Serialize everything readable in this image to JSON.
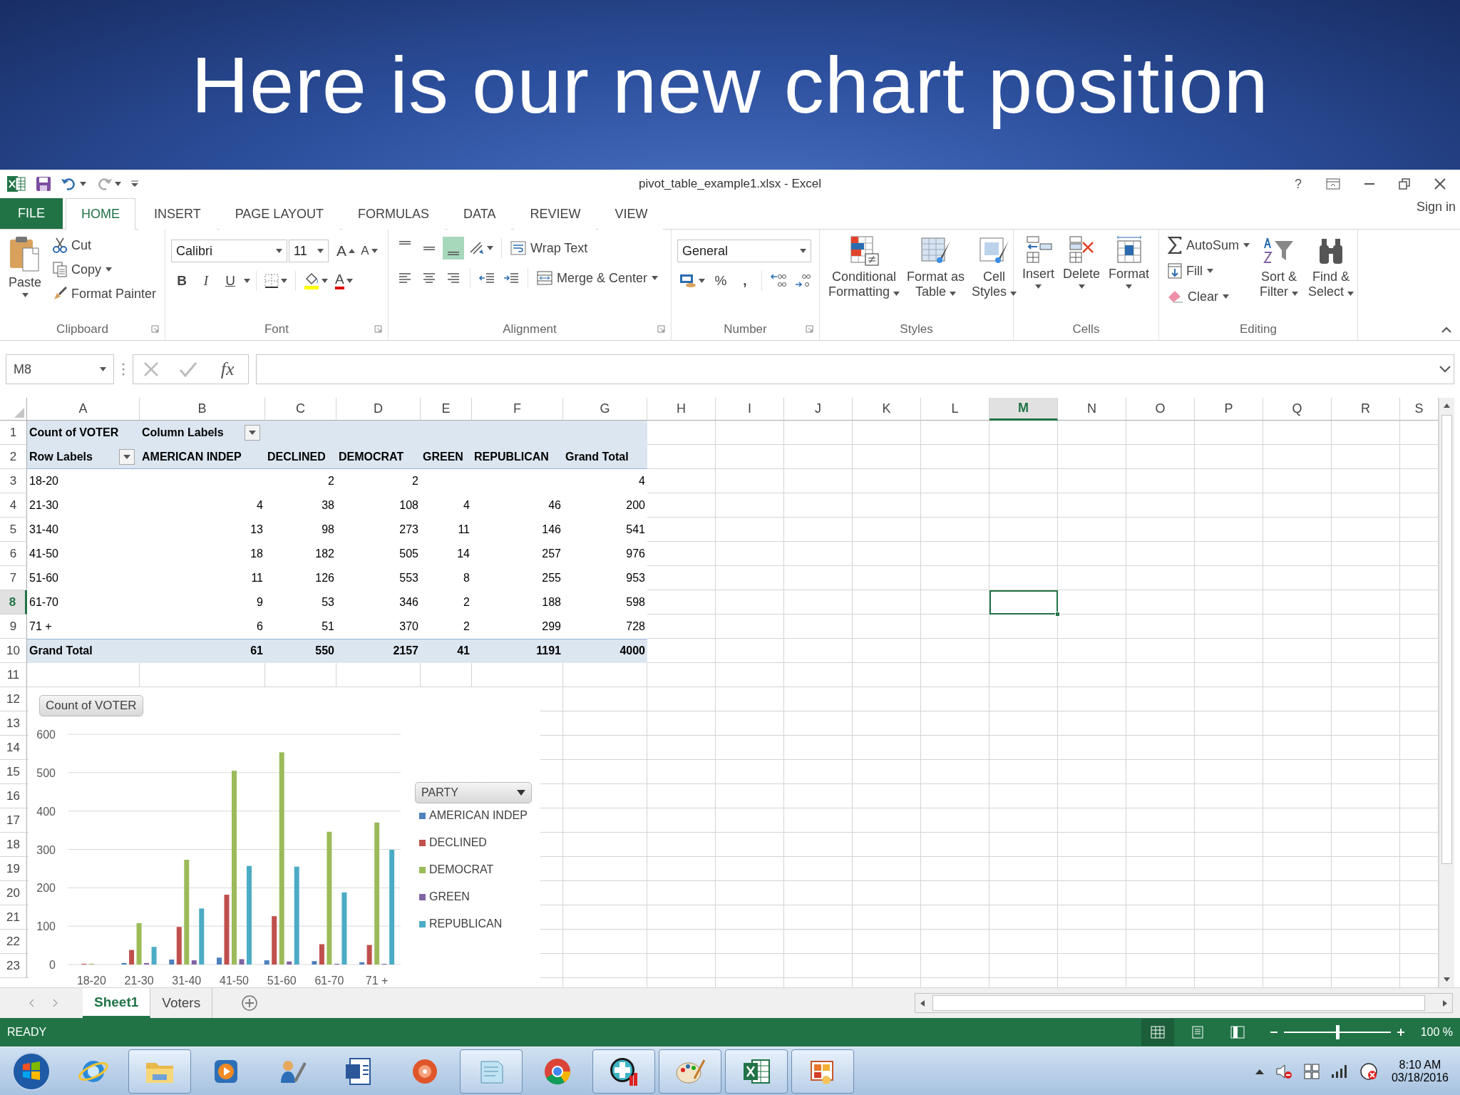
{
  "slide_title": "Here is our new chart position",
  "window": {
    "title": "pivot_table_example1.xlsx - Excel",
    "help": "?",
    "sign_in": "Sign in"
  },
  "ribbon_tabs": [
    {
      "label": "FILE",
      "kind": "file",
      "selected": false
    },
    {
      "label": "HOME",
      "kind": "tab",
      "selected": true
    },
    {
      "label": "INSERT",
      "kind": "tab",
      "selected": false
    },
    {
      "label": "PAGE LAYOUT",
      "kind": "tab",
      "selected": false
    },
    {
      "label": "FORMULAS",
      "kind": "tab",
      "selected": false
    },
    {
      "label": "DATA",
      "kind": "tab",
      "selected": false
    },
    {
      "label": "REVIEW",
      "kind": "tab",
      "selected": false
    },
    {
      "label": "VIEW",
      "kind": "tab",
      "selected": false
    }
  ],
  "ribbon": {
    "clipboard": {
      "label": "Clipboard",
      "paste": "Paste",
      "cut": "Cut",
      "copy": "Copy",
      "format_painter": "Format Painter"
    },
    "font": {
      "label": "Font",
      "font_name": "Calibri",
      "font_size": "11",
      "grow": "A",
      "shrink": "A",
      "bold": "B",
      "italic": "I",
      "underline": "U",
      "font_color": "A"
    },
    "alignment": {
      "label": "Alignment",
      "vertical_align": [
        {
          "selected": false
        },
        {
          "selected": false
        },
        {
          "selected": true
        }
      ],
      "wrap_text": "Wrap Text",
      "merge_center": "Merge & Center"
    },
    "number": {
      "label": "Number",
      "format": "General",
      "percent": "%",
      "comma": ","
    },
    "styles": {
      "label": "Styles",
      "buttons": [
        [
          "Conditional",
          "Formatting"
        ],
        [
          "Format as",
          "Table"
        ],
        [
          "Cell",
          "Styles"
        ]
      ]
    },
    "cells": {
      "label": "Cells",
      "buttons": [
        "Insert",
        "Delete",
        "Format"
      ]
    },
    "editing": {
      "label": "Editing",
      "autosum": "AutoSum",
      "fill": "Fill",
      "clear": "Clear",
      "sort_filter": [
        "Sort &",
        "Filter"
      ],
      "find_select": [
        "Find &",
        "Select"
      ]
    }
  },
  "formula_bar": {
    "name_box": "M8",
    "function_label": "fx"
  },
  "sheet": {
    "columns": [
      {
        "label": "A",
        "selected": false
      },
      {
        "label": "B",
        "selected": false
      },
      {
        "label": "C",
        "selected": false
      },
      {
        "label": "D",
        "selected": false
      },
      {
        "label": "E",
        "selected": false
      },
      {
        "label": "F",
        "selected": false
      },
      {
        "label": "G",
        "selected": false
      },
      {
        "label": "H",
        "selected": false
      },
      {
        "label": "I",
        "selected": false
      },
      {
        "label": "J",
        "selected": false
      },
      {
        "label": "K",
        "selected": false
      },
      {
        "label": "L",
        "selected": false
      },
      {
        "label": "M",
        "selected": true
      },
      {
        "label": "N",
        "selected": false
      },
      {
        "label": "O",
        "selected": false
      },
      {
        "label": "P",
        "selected": false
      },
      {
        "label": "Q",
        "selected": false
      },
      {
        "label": "R",
        "selected": false
      },
      {
        "label": "S",
        "selected": false
      }
    ],
    "rows": [
      {
        "label": "1",
        "selected": false
      },
      {
        "label": "2",
        "selected": false
      },
      {
        "label": "3",
        "selected": false
      },
      {
        "label": "4",
        "selected": false
      },
      {
        "label": "5",
        "selected": false
      },
      {
        "label": "6",
        "selected": false
      },
      {
        "label": "7",
        "selected": false
      },
      {
        "label": "8",
        "selected": true
      },
      {
        "label": "9",
        "selected": false
      },
      {
        "label": "10",
        "selected": false
      },
      {
        "label": "11",
        "selected": false
      },
      {
        "label": "12",
        "selected": false
      },
      {
        "label": "13",
        "selected": false
      },
      {
        "label": "14",
        "selected": false
      },
      {
        "label": "15",
        "selected": false
      },
      {
        "label": "16",
        "selected": false
      },
      {
        "label": "17",
        "selected": false
      },
      {
        "label": "18",
        "selected": false
      },
      {
        "label": "19",
        "selected": false
      },
      {
        "label": "20",
        "selected": false
      },
      {
        "label": "21",
        "selected": false
      },
      {
        "label": "22",
        "selected": false
      },
      {
        "label": "23",
        "selected": false
      }
    ],
    "pivot": {
      "header": [
        "Count of VOTER",
        "Column Labels"
      ],
      "subheader": [
        "Row Labels",
        "AMERICAN INDEP",
        "DECLINED",
        "DEMOCRAT",
        "GREEN",
        "REPUBLICAN",
        "Grand Total"
      ],
      "rows": [
        [
          "18-20",
          null,
          "2",
          "2",
          null,
          null,
          "4"
        ],
        [
          "21-30",
          "4",
          "38",
          "108",
          "4",
          "46",
          "200"
        ],
        [
          "31-40",
          "13",
          "98",
          "273",
          "11",
          "146",
          "541"
        ],
        [
          "41-50",
          "18",
          "182",
          "505",
          "14",
          "257",
          "976"
        ],
        [
          "51-60",
          "11",
          "126",
          "553",
          "8",
          "255",
          "953"
        ],
        [
          "61-70",
          "9",
          "53",
          "346",
          "2",
          "188",
          "598"
        ],
        [
          "71 +",
          "6",
          "51",
          "370",
          "2",
          "299",
          "728"
        ]
      ],
      "total": [
        "Grand Total",
        "61",
        "550",
        "2157",
        "41",
        "1191",
        "4000"
      ]
    }
  },
  "chart": {
    "field_button": "Count of VOTER",
    "legend_title": "PARTY",
    "chart_data": {
      "type": "bar",
      "categories": [
        "18-20",
        "21-30",
        "31-40",
        "41-50",
        "51-60",
        "61-70",
        "71 +"
      ],
      "series": [
        {
          "name": "AMERICAN INDEP",
          "color": "#4f81bd",
          "values": [
            null,
            4,
            13,
            18,
            11,
            9,
            6
          ]
        },
        {
          "name": "DECLINED",
          "color": "#c0504d",
          "values": [
            2,
            38,
            98,
            182,
            126,
            53,
            51
          ]
        },
        {
          "name": "DEMOCRAT",
          "color": "#9bbb59",
          "values": [
            2,
            108,
            273,
            505,
            553,
            346,
            370
          ]
        },
        {
          "name": "GREEN",
          "color": "#8064a2",
          "values": [
            null,
            4,
            11,
            14,
            8,
            2,
            2
          ]
        },
        {
          "name": "REPUBLICAN",
          "color": "#4bacc6",
          "values": [
            null,
            46,
            146,
            257,
            255,
            188,
            299
          ]
        }
      ],
      "ylim": [
        0,
        600
      ],
      "yticks": [
        0,
        100,
        200,
        300,
        400,
        500,
        600
      ],
      "grid": true,
      "legend": true
    }
  },
  "sheet_tabs": [
    {
      "label": "Sheet1",
      "selected": true
    },
    {
      "label": "Voters",
      "selected": false
    }
  ],
  "status_bar": {
    "mode": "READY",
    "views": [
      {
        "selected": true
      },
      {
        "selected": false
      },
      {
        "selected": false
      }
    ],
    "zoom": {
      "level": 0.5,
      "label": "100 %"
    }
  },
  "taskbar": {
    "apps": [
      {
        "open": false
      },
      {
        "open": true
      },
      {
        "open": false
      },
      {
        "open": false
      },
      {
        "open": false
      },
      {
        "open": false
      },
      {
        "open": true
      },
      {
        "open": false
      },
      {
        "open": true
      },
      {
        "open": true
      },
      {
        "open": true
      },
      {
        "open": true
      }
    ],
    "time": "8:10 AM",
    "date": "03/18/2016"
  }
}
